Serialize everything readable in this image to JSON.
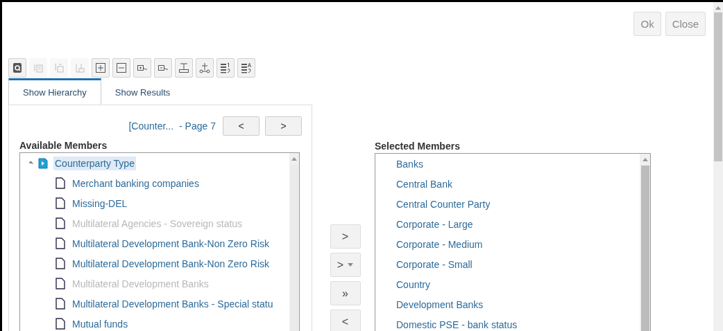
{
  "dialog_buttons": [
    "Ok",
    "Close"
  ],
  "toolbar": [
    {
      "disabled": false
    },
    {
      "disabled": true
    },
    {
      "disabled": true
    },
    {
      "disabled": true
    },
    {
      "disabled": false
    },
    {
      "disabled": false
    },
    {
      "disabled": false
    },
    {
      "disabled": false
    },
    {
      "disabled": false
    },
    {
      "disabled": false
    },
    {
      "disabled": false
    },
    {
      "disabled": false
    }
  ],
  "tabs": [
    {
      "label": "Show Hierarchy",
      "selected": true
    },
    {
      "label": "Show Results",
      "selected": false
    }
  ],
  "pager": {
    "link": "[Counter...",
    "page": "- Page 7",
    "prev": "<",
    "next": ">"
  },
  "available_members": {
    "label": "Available Members",
    "tree": [
      {
        "label": "Counterparty Type",
        "expanded": true,
        "selected": true,
        "disabled": false,
        "children": [
          {
            "label": "Merchant banking companies",
            "selected": false,
            "disabled": false
          },
          {
            "label": "Missing-DEL",
            "selected": false,
            "disabled": false
          },
          {
            "label": "Multilateral Agencies - Sovereign status",
            "selected": false,
            "disabled": true
          },
          {
            "label": "Multilateral Development Bank-Non Zero Risk",
            "selected": false,
            "disabled": false
          },
          {
            "label": "Multilateral Development Bank-Non Zero Risk",
            "selected": false,
            "disabled": false
          },
          {
            "label": "Multilateral Development Banks",
            "selected": false,
            "disabled": true
          },
          {
            "label": "Multilateral Development Banks - Special statu",
            "selected": false,
            "disabled": false
          },
          {
            "label": "Mutual funds",
            "selected": false,
            "disabled": false
          }
        ]
      }
    ]
  },
  "move_buttons": [
    {
      "label": ">",
      "menu": false
    },
    {
      "label": ">",
      "menu": true
    },
    {
      "label": "»",
      "menu": false
    },
    {
      "label": "<",
      "menu": false
    }
  ],
  "selected_members": {
    "label": "Selected Members",
    "items": [
      "Banks",
      "Central Bank",
      "Central Counter Party",
      "Corporate - Large",
      "Corporate - Medium",
      "Corporate - Small",
      "Country",
      "Development Banks",
      "Domestic PSE - bank status"
    ]
  }
}
